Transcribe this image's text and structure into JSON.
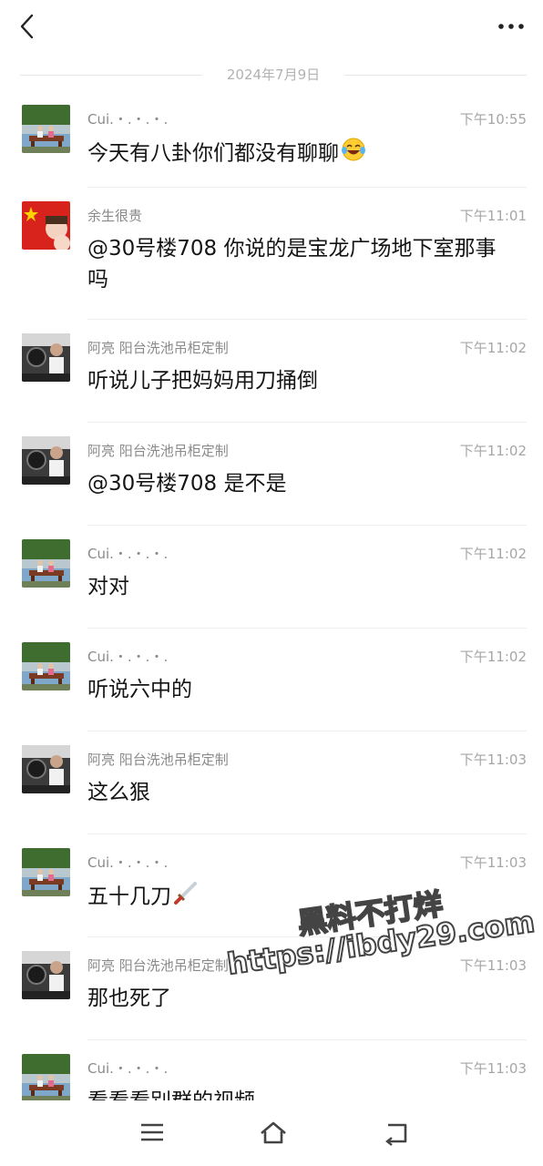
{
  "header": {
    "back_icon": "chevron-left-icon",
    "more_icon": "more-dots-icon"
  },
  "date_separator": "2024年7月9日",
  "messages": [
    {
      "sender": "Cui.・.・.・.",
      "time": "下午10:55",
      "text": "今天有八卦你们都没有聊聊",
      "emoji": "laughing-tears-emoji",
      "avatar": "cui"
    },
    {
      "sender": "余生很贵",
      "time": "下午11:01",
      "text": "@30号楼708 你说的是宝龙广场地下室那事吗",
      "avatar": "flag"
    },
    {
      "sender": "阿亮 阳台洗池吊柜定制",
      "time": "下午11:02",
      "text": "听说儿子把妈妈用刀捅倒",
      "avatar": "aliang"
    },
    {
      "sender": "阿亮 阳台洗池吊柜定制",
      "time": "下午11:02",
      "text": "@30号楼708 是不是",
      "avatar": "aliang"
    },
    {
      "sender": "Cui.・.・.・.",
      "time": "下午11:02",
      "text": "对对",
      "avatar": "cui"
    },
    {
      "sender": "Cui.・.・.・.",
      "time": "下午11:02",
      "text": "听说六中的",
      "avatar": "cui"
    },
    {
      "sender": "阿亮 阳台洗池吊柜定制",
      "time": "下午11:03",
      "text": "这么狠",
      "avatar": "aliang"
    },
    {
      "sender": "Cui.・.・.・.",
      "time": "下午11:03",
      "text": "五十几刀",
      "emoji": "dagger-emoji",
      "avatar": "cui"
    },
    {
      "sender": "阿亮 阳台洗池吊柜定制",
      "time": "下午11:03",
      "text": "那也死了",
      "avatar": "aliang"
    },
    {
      "sender": "Cui.・.・.・.",
      "time": "下午11:03",
      "text": "看看看别群的视频",
      "avatar": "cui"
    }
  ],
  "watermark": {
    "line1": "黑料不打烊",
    "line2": "https://ibdy29.com"
  },
  "navbar": {
    "icons": [
      "menu-icon",
      "home-icon",
      "back-arrow-icon"
    ]
  }
}
